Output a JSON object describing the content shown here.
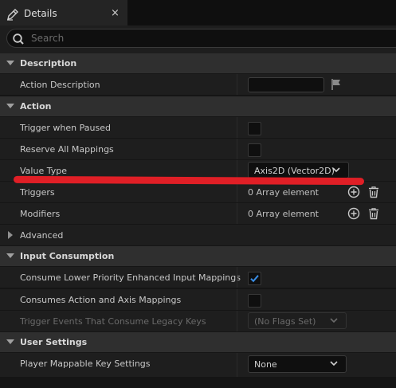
{
  "tab": {
    "title": "Details",
    "close": "×"
  },
  "search": {
    "placeholder": "Search"
  },
  "sections": {
    "description": "Description",
    "action": "Action",
    "input_consumption": "Input Consumption",
    "user_settings": "User Settings"
  },
  "rows": {
    "action_description": {
      "label": "Action Description",
      "value": ""
    },
    "trigger_when_paused": {
      "label": "Trigger when Paused",
      "checked": false
    },
    "reserve_all_mappings": {
      "label": "Reserve All Mappings",
      "checked": false
    },
    "value_type": {
      "label": "Value Type",
      "value": "Axis2D (Vector2D)"
    },
    "triggers": {
      "label": "Triggers",
      "value": "0 Array element"
    },
    "modifiers": {
      "label": "Modifiers",
      "value": "0 Array element"
    },
    "advanced": {
      "label": "Advanced"
    },
    "consume_lower_priority": {
      "label": "Consume Lower Priority Enhanced Input Mappings",
      "checked": true
    },
    "consumes_action_axis": {
      "label": "Consumes Action and Axis Mappings",
      "checked": false
    },
    "trigger_events_legacy": {
      "label": "Trigger Events That Consume Legacy Keys",
      "value": "(No Flags Set)"
    },
    "player_mappable": {
      "label": "Player Mappable Key Settings",
      "value": "None"
    }
  },
  "icons": {
    "tab": "pencil-icon",
    "search": "search-icon",
    "flag": "flag-icon",
    "add": "plus-circle-icon",
    "delete": "trash-icon",
    "dropdown": "chevron-down-icon"
  },
  "colors": {
    "accent": "#3a8ee6",
    "annotation": "#e01f26"
  }
}
